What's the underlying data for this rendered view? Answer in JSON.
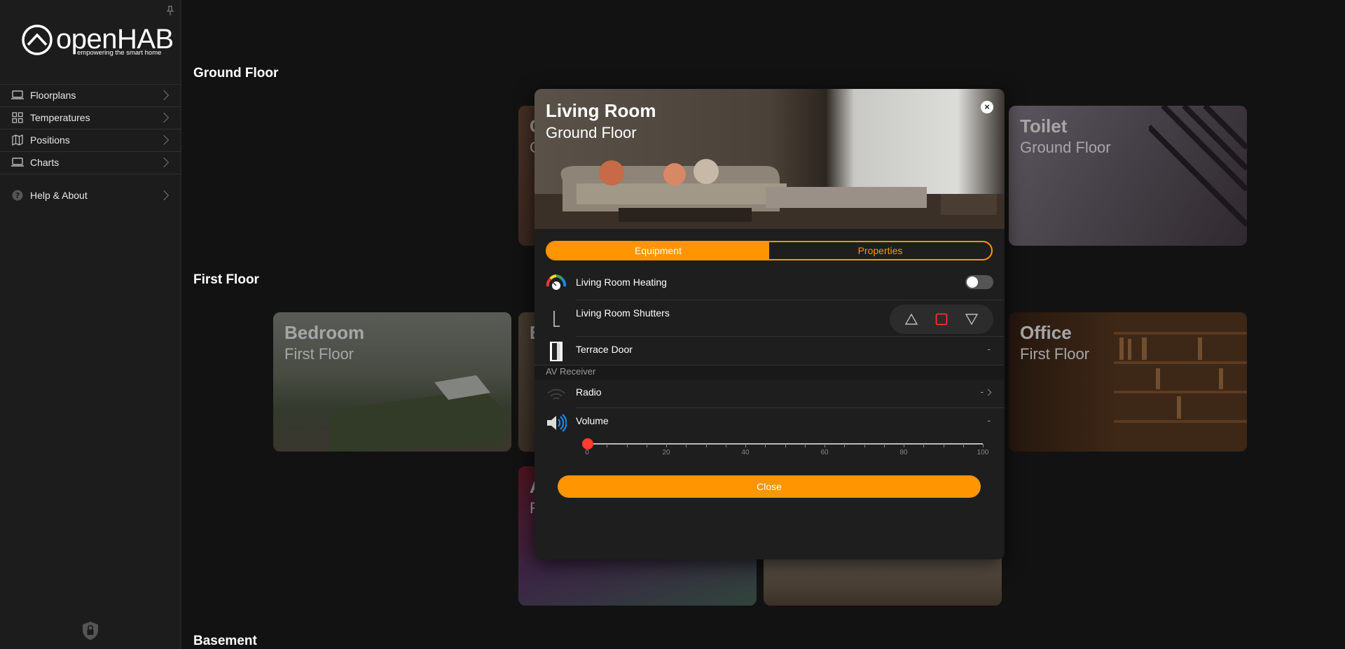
{
  "sidebar": {
    "logo_word": "openHAB",
    "logo_tagline": "empowering the smart home",
    "items": [
      {
        "label": "Floorplans"
      },
      {
        "label": "Temperatures"
      },
      {
        "label": "Positions"
      },
      {
        "label": "Charts"
      }
    ],
    "help_label": "Help & About"
  },
  "sections": {
    "ground_floor": "Ground Floor",
    "first_floor": "First Floor",
    "basement": "Basement"
  },
  "cards": {
    "toilet": {
      "title": "Toilet",
      "subtitle": "Ground Floor"
    },
    "bedroom": {
      "title": "Bedroom",
      "subtitle": "First Floor"
    },
    "office": {
      "title": "Office",
      "subtitle": "First Floor"
    },
    "partial_gf": {
      "title": "C",
      "subtitle": "G"
    },
    "partial_ff1": {
      "title": "B",
      "subtitle": ""
    },
    "partial_ff2": {
      "title": "A",
      "subtitle": "F"
    }
  },
  "popup": {
    "title": "Living Room",
    "subtitle": "Ground Floor",
    "tabs": [
      "Equipment",
      "Properties"
    ],
    "rows": {
      "heating": {
        "label": "Living Room Heating"
      },
      "shutters": {
        "label": "Living Room Shutters"
      },
      "terrace": {
        "label": "Terrace Door",
        "value": "-"
      },
      "group": "AV Receiver",
      "radio": {
        "label": "Radio",
        "value": "-"
      },
      "volume": {
        "label": "Volume",
        "value": "-"
      }
    },
    "slider": {
      "value": 0,
      "min": 0,
      "max": 100,
      "labels": [
        "0",
        "20",
        "40",
        "60",
        "80",
        "100"
      ]
    },
    "close_label": "Close"
  },
  "colors": {
    "accent": "#ff9500",
    "slider_thumb": "#ff3b30"
  }
}
